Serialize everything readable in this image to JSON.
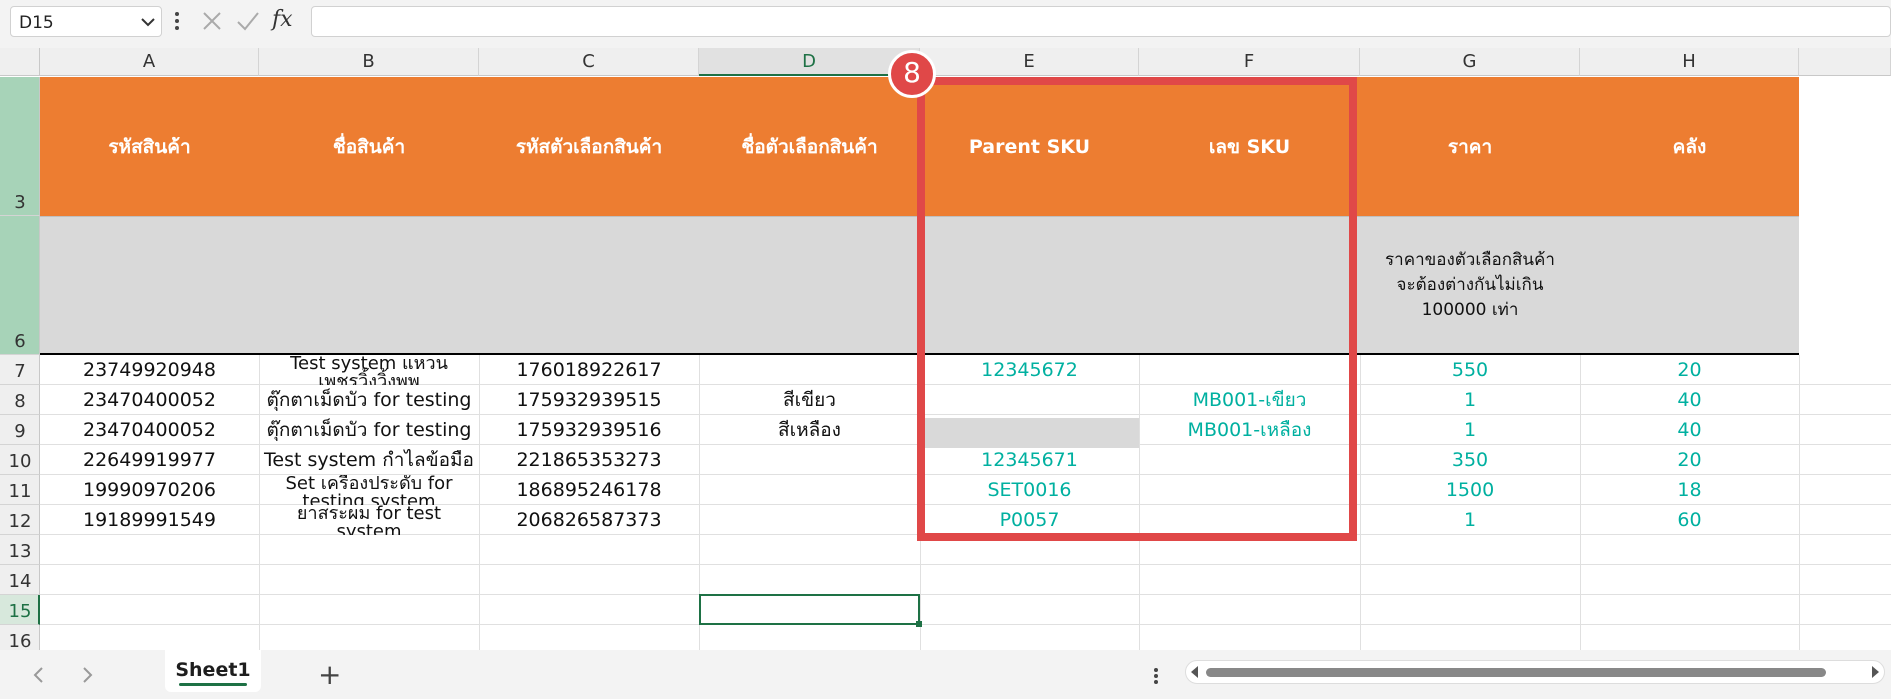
{
  "formula_bar": {
    "name_box": "D15",
    "fx_label": "fx",
    "formula": ""
  },
  "columns": [
    "A",
    "B",
    "C",
    "D",
    "E",
    "F",
    "G",
    "H"
  ],
  "header_row": {
    "row_number": "3",
    "cells": [
      "รหัสสินค้า",
      "ชื่อสินค้า",
      "รหัสตัวเลือกสินค้า",
      "ชื่อตัวเลือกสินค้า",
      "Parent SKU",
      "เลข SKU",
      "ราคา",
      "คลัง"
    ]
  },
  "note_row": {
    "row_number": "6",
    "note_lines": [
      "ราคาของตัวเลือกสินค้า",
      "จะต้องต่างกันไม่เกิน",
      "100000 เท่า"
    ]
  },
  "rows": [
    {
      "num": "7",
      "a": "23749920948",
      "b": [
        "Test system แหวน",
        "เพชรวิ้งวิ้งพพ"
      ],
      "c": "176018922617",
      "d": "",
      "e": "12345672",
      "f": "",
      "g": "550",
      "h": "20"
    },
    {
      "num": "8",
      "a": "23470400052",
      "b": [
        "ตุ๊กตาเม็ดบัว for testing"
      ],
      "c": "175932939515",
      "d": "สีเขียว",
      "e": "",
      "f": "MB001-เขียว",
      "g": "1",
      "h": "40"
    },
    {
      "num": "9",
      "a": "23470400052",
      "b": [
        "ตุ๊กตาเม็ดบัว for testing"
      ],
      "c": "175932939516",
      "d": "สีเหลือง",
      "e": "",
      "f": "MB001-เหลือง",
      "g": "1",
      "h": "40"
    },
    {
      "num": "10",
      "a": "22649919977",
      "b": [
        "Test system กำไลข้อมือ"
      ],
      "c": "221865353273",
      "d": "",
      "e": "12345671",
      "f": "",
      "g": "350",
      "h": "20"
    },
    {
      "num": "11",
      "a": "19990970206",
      "b": [
        "Set เครื่องประดับ for",
        "testing system"
      ],
      "c": "186895246178",
      "d": "",
      "e": "SET0016",
      "f": "",
      "g": "1500",
      "h": "18"
    },
    {
      "num": "12",
      "a": "19189991549",
      "b": [
        "ยาสระผม for test",
        "system"
      ],
      "c": "206826587373",
      "d": "",
      "e": "P0057",
      "f": "",
      "g": "1",
      "h": "60"
    }
  ],
  "empty_rows": [
    "13",
    "14",
    "15",
    "16"
  ],
  "selected_cell": "D15",
  "annotation": {
    "badge": "8",
    "color": "#e04848"
  },
  "sheet_tabs": {
    "active": "Sheet1",
    "add_label": "+"
  },
  "colors": {
    "header_orange": "#ed7d31",
    "note_grey": "#d9d9d9",
    "value_teal": "#00b0a0",
    "excel_green": "#1e7145"
  }
}
